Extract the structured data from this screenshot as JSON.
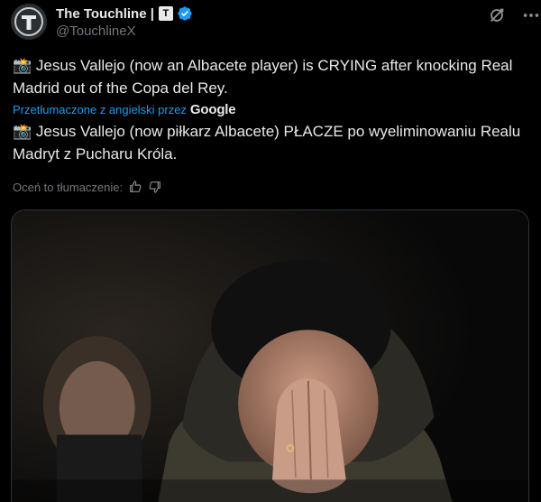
{
  "header": {
    "display_name": "The Touchline | ",
    "label_badge": "T",
    "handle": "@TouchlineX",
    "avatar_letter": "T",
    "icons": [
      "grok-icon",
      "more-icon",
      "verified-icon"
    ]
  },
  "tweet": {
    "emoji": "📸",
    "text": "Jesus Vallejo (now an Albacete player) is CRYING after knocking Real Madrid out of the Copa del Rey."
  },
  "translation": {
    "translated_by": "Przetłumaczone z angielski przez",
    "provider": "Google",
    "emoji": "📸",
    "text": "Jesus Vallejo (now piłkarz Albacete) PŁACZE po wyeliminowaniu Realu Madryt z Pucharu Króla."
  },
  "rate": {
    "label": "Oceń to tłumaczenie:",
    "icons": [
      "thumbs-up-icon",
      "thumbs-down-icon"
    ]
  },
  "media": {
    "type": "photo"
  },
  "colors": {
    "background": "#000000",
    "text": "#e7e9ea",
    "secondary": "#71767b",
    "link": "#1d9bf0",
    "verified": "#1d9bf0"
  }
}
